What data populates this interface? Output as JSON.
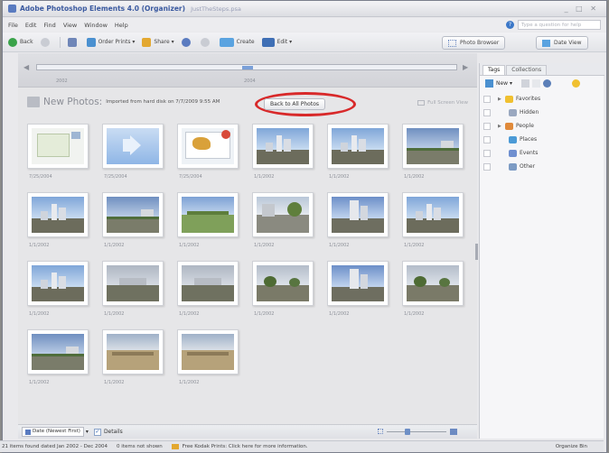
{
  "window": {
    "app_title": "Adobe Photoshop Elements 4.0 (Organizer)",
    "file_name": "JustTheSteps.psa",
    "controls": "_ □ ✕"
  },
  "menu": [
    "File",
    "Edit",
    "Find",
    "View",
    "Window",
    "Help"
  ],
  "help_search": {
    "placeholder": "Type a question for help"
  },
  "toolbar": {
    "back": "Back",
    "order_prints": "Order Prints ▾",
    "share": "Share ▾",
    "create": "Create",
    "edit": "Edit ▾",
    "photo_browser": "Photo Browser",
    "date_view": "Date View"
  },
  "timeline": {
    "year_left": "2002",
    "year_mid": "2004"
  },
  "header": {
    "title": "New Photos:",
    "subtitle": "Imported from hard disk on 7/7/2009 9:55 AM",
    "back_to_all": "Back to All Photos",
    "full_screen": "Full Screen View"
  },
  "photos": [
    {
      "date": "7/25/2004",
      "kind": "doc"
    },
    {
      "date": "7/25/2004",
      "kind": "audio"
    },
    {
      "date": "7/25/2004",
      "kind": "map"
    },
    {
      "date": "1/1/2002",
      "kind": "city"
    },
    {
      "date": "1/1/2002",
      "kind": "city"
    },
    {
      "date": "1/1/2002",
      "kind": "road"
    },
    {
      "date": "1/1/2002",
      "kind": "city"
    },
    {
      "date": "1/1/2002",
      "kind": "road"
    },
    {
      "date": "1/1/2002",
      "kind": "field"
    },
    {
      "date": "1/1/2002",
      "kind": "street"
    },
    {
      "date": "1/1/2002",
      "kind": "tower"
    },
    {
      "date": "1/1/2002",
      "kind": "city"
    },
    {
      "date": "1/1/2002",
      "kind": "city"
    },
    {
      "date": "1/1/2002",
      "kind": "cloudy"
    },
    {
      "date": "1/1/2002",
      "kind": "cloudy"
    },
    {
      "date": "1/1/2002",
      "kind": "trees"
    },
    {
      "date": "1/1/2002",
      "kind": "tower"
    },
    {
      "date": "1/1/2002",
      "kind": "trees"
    },
    {
      "date": "1/1/2002",
      "kind": "road"
    },
    {
      "date": "1/1/2002",
      "kind": "beach"
    },
    {
      "date": "1/1/2002",
      "kind": "beach"
    }
  ],
  "bottom": {
    "sort": "Date (Newest First)",
    "details": "Details"
  },
  "status": {
    "found": "21 items found dated Jan 2002 - Dec 2004",
    "not_shown": "0 items not shown",
    "kodak": "Free Kodak Prints: Click here for more information.",
    "organize_bin": "Organize Bin"
  },
  "tags_panel": {
    "tabs": [
      "Tags",
      "Collections"
    ],
    "new": "New ▾",
    "items": [
      {
        "label": "Favorites",
        "color": "#f0c030",
        "expand": true
      },
      {
        "label": "Hidden",
        "color": "#9aa8c0",
        "expand": false
      },
      {
        "label": "People",
        "color": "#e08a3a",
        "expand": true
      },
      {
        "label": "Places",
        "color": "#4b9ad6",
        "expand": false
      },
      {
        "label": "Events",
        "color": "#6f8fd0",
        "expand": false
      },
      {
        "label": "Other",
        "color": "#7c9bc4",
        "expand": false
      }
    ]
  },
  "colors": {
    "accent_red": "#d8292a",
    "title_blue": "#3b5aa0"
  }
}
